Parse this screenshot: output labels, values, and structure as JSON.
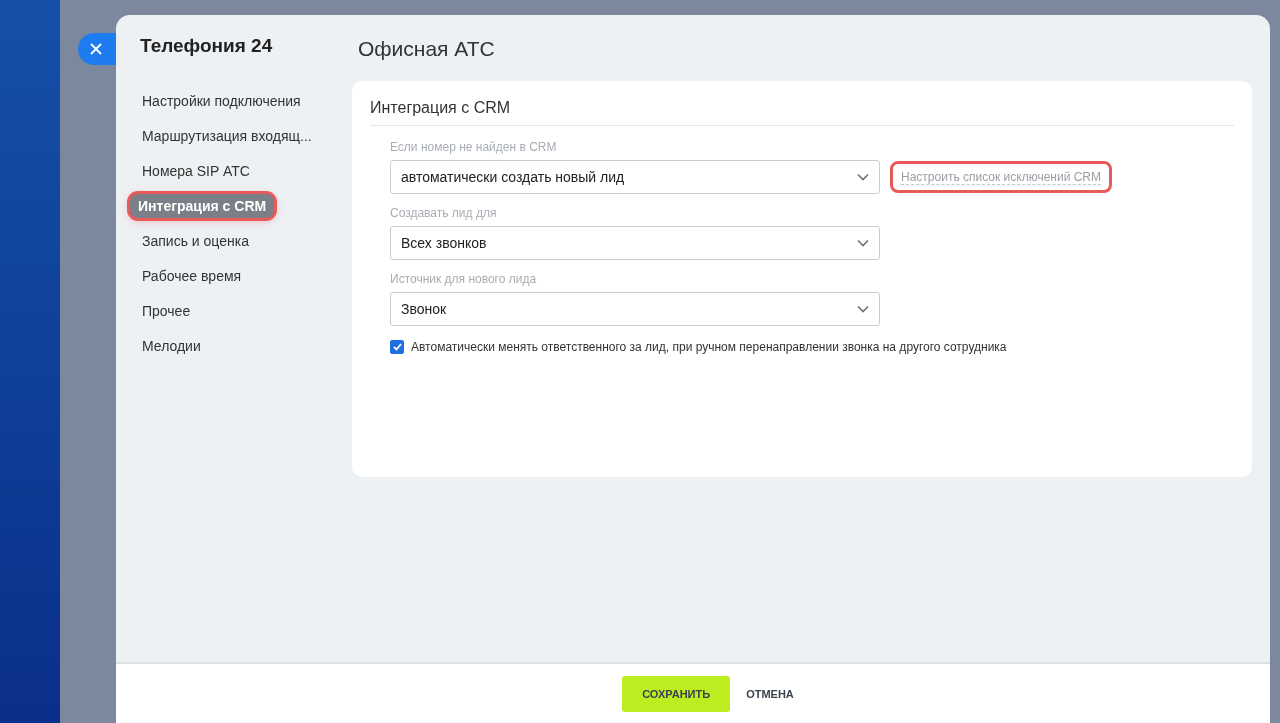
{
  "app_title": "Телефония 24",
  "sidebar": {
    "items": [
      {
        "label": "Настройки подключения",
        "selected": false
      },
      {
        "label": "Маршрутизация входящ...",
        "selected": false
      },
      {
        "label": "Номера SIP АТС",
        "selected": false
      },
      {
        "label": "Интеграция с CRM",
        "selected": true
      },
      {
        "label": "Запись и оценка",
        "selected": false
      },
      {
        "label": "Рабочее время",
        "selected": false
      },
      {
        "label": "Прочее",
        "selected": false
      },
      {
        "label": "Мелодии",
        "selected": false
      }
    ]
  },
  "page_title": "Офисная АТС",
  "section": {
    "title": "Интеграция с CRM",
    "fields": [
      {
        "label": "Если номер не найден в CRM",
        "value": "автоматически создать новый лид",
        "link": {
          "text": "Настроить список исключений CRM",
          "highlighted": true
        }
      },
      {
        "label": "Создавать лид для",
        "value": "Всех звонков"
      },
      {
        "label": "Источник для нового лида",
        "value": "Звонок"
      }
    ],
    "checkbox": {
      "label": "Автоматически менять ответственного за лид, при ручном перенаправлении звонка на другого сотрудника",
      "checked": true
    }
  },
  "buttons": {
    "save": "СОХРАНИТЬ",
    "cancel": "ОТМЕНА"
  }
}
